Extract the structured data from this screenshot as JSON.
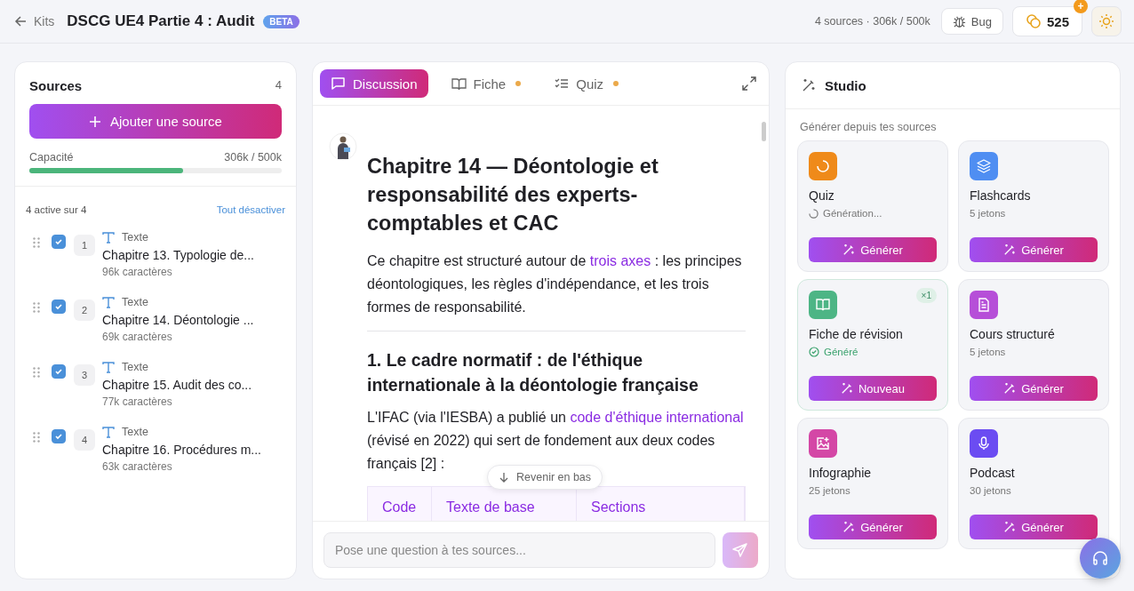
{
  "header": {
    "back_link": "Kits",
    "title": "DSCG UE4 Partie 4 : Audit",
    "badge": "BETA",
    "stats": "4 sources · 306k / 500k",
    "bug_button": "Bug",
    "credits": "525",
    "credits_badge": "+"
  },
  "sources": {
    "title": "Sources",
    "count": "4",
    "add_button": "Ajouter une source",
    "capacity": {
      "label": "Capacité",
      "reading": "306k / 500k",
      "level": 0.61
    },
    "active_summary": "4 active sur 4",
    "toggle_all": "Tout désactiver",
    "items": [
      {
        "number": "1",
        "type": "Texte",
        "title": "Chapitre 13. Typologie de...",
        "size": "96k caractères",
        "checked": true
      },
      {
        "number": "2",
        "type": "Texte",
        "title": "Chapitre 14. Déontologie ...",
        "size": "69k caractères",
        "checked": true
      },
      {
        "number": "3",
        "type": "Texte",
        "title": "Chapitre 15. Audit des co...",
        "size": "77k caractères",
        "checked": true
      },
      {
        "number": "4",
        "type": "Texte",
        "title": "Chapitre 16. Procédures m...",
        "size": "63k caractères",
        "checked": true
      }
    ]
  },
  "chat": {
    "tabs": [
      {
        "label": "Discussion",
        "kind": "chat",
        "selected": true,
        "dot": false
      },
      {
        "label": "Fiche",
        "kind": "book",
        "selected": false,
        "dot": true
      },
      {
        "label": "Quiz",
        "kind": "list",
        "selected": false,
        "dot": true
      }
    ],
    "heading": "Chapitre 14 — Déontologie et responsabilité des experts-comptables et CAC",
    "intro": [
      {
        "kind": "text",
        "text": "Ce chapitre est structuré autour de "
      },
      {
        "kind": "link",
        "text": "trois axes"
      },
      {
        "kind": "text",
        "text": " : les principes déontologiques, les règles d'indépendance, et les trois formes de responsabilité."
      }
    ],
    "section_heading": "1. Le cadre normatif : de l'éthique internationale à la déontologie française",
    "section_text": [
      {
        "kind": "text",
        "text": "L'IFAC (via l'IESBA) a publié un "
      },
      {
        "kind": "link",
        "text": "code d'éthique international"
      },
      {
        "kind": "text",
        "text": " (révisé en 2022) qui sert de fondement aux deux codes français [2] :"
      }
    ],
    "table_columns": [
      "Code",
      "Texte de base",
      "Sections"
    ],
    "scroll_button": "Revenir en bas",
    "composer": {
      "placeholder": "Pose une question à tes sources...",
      "send_disabled": true
    }
  },
  "studio": {
    "title": "Studio",
    "subtitle": "Générer depuis tes sources",
    "cards": [
      {
        "title": "Quiz",
        "color": "#ef8a1a",
        "kind": "loading",
        "status": "Génération...",
        "button": "Générer"
      },
      {
        "title": "Flashcards",
        "color": "#4f8ef2",
        "kind": "tokens",
        "status": "5 jetons",
        "button": "Générer"
      },
      {
        "title": "Fiche de révision",
        "color": "#4db585",
        "kind": "done",
        "status": "Généré",
        "button": "Nouveau",
        "count": "×1"
      },
      {
        "title": "Cours structuré",
        "color": "#b64fd8",
        "kind": "tokens",
        "status": "5 jetons",
        "button": "Générer"
      },
      {
        "title": "Infographie",
        "color": "#d447a6",
        "kind": "tokens",
        "status": "25 jetons",
        "button": "Générer"
      },
      {
        "title": "Podcast",
        "color": "#6b4cf2",
        "kind": "tokens",
        "status": "30 jetons",
        "button": "Générer"
      }
    ]
  }
}
